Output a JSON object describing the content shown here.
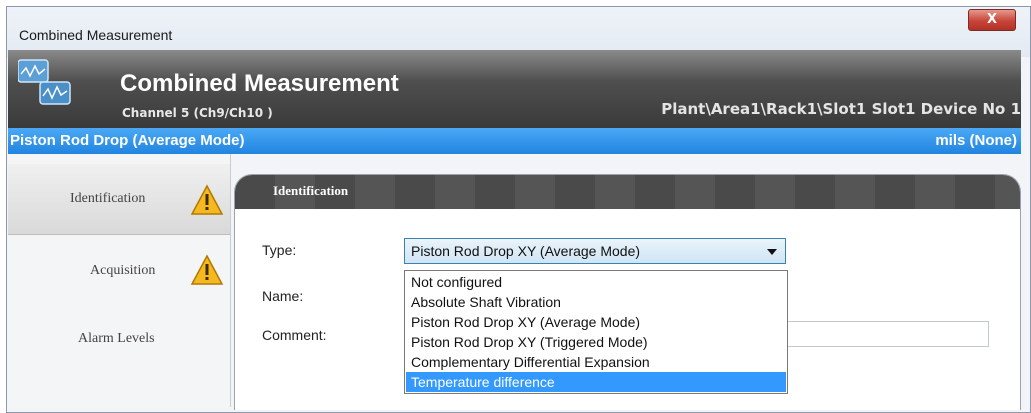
{
  "window": {
    "title": "Combined Measurement",
    "close_label": "X"
  },
  "header": {
    "title": "Combined Measurement",
    "subtitle": "Channel 5 (Ch9/Ch10 )",
    "path": "Plant\\Area1\\Rack1\\Slot1 Slot1 Device No 1"
  },
  "measurement_bar": {
    "name": "Piston Rod Drop (Average Mode)",
    "units": "mils (None)"
  },
  "sidebar": {
    "items": [
      {
        "label": "Identification",
        "warning": true,
        "active": true
      },
      {
        "label": "Acquisition",
        "warning": true,
        "active": false
      },
      {
        "label": "Alarm Levels",
        "warning": false,
        "active": false
      }
    ]
  },
  "panel": {
    "title": "Identification",
    "type_label": "Type:",
    "name_label": "Name:",
    "comment_label": "Comment:",
    "type_value": "Piston Rod Drop XY (Average Mode)",
    "comment_value": "",
    "type_options": [
      "Not configured",
      "Absolute Shaft Vibration",
      "Piston Rod Drop XY (Average Mode)",
      "Piston Rod Drop XY (Triggered Mode)",
      "Complementary Differential Expansion",
      "Temperature difference"
    ],
    "highlighted_option": "Temperature difference"
  },
  "colors": {
    "accent_blue": "#2184e0",
    "highlight": "#3399ff",
    "header_dark": "#3a3a3a",
    "close_red": "#c8443a",
    "warning_yellow": "#f5b820"
  }
}
